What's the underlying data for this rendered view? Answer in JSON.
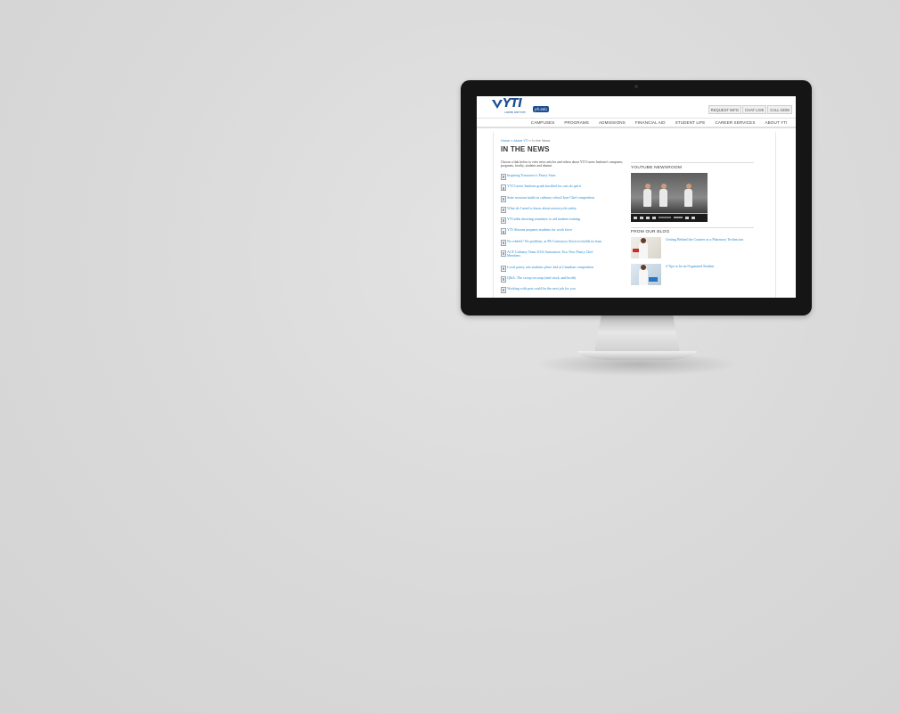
{
  "header": {
    "logo_text": "YTI",
    "logo_sub": "CAREER INSTITUTE",
    "logo_badge": "yti.edu",
    "top_buttons": [
      "REQUEST INFO",
      "CHAT LIVE",
      "CALL NOW"
    ]
  },
  "nav": [
    "CAMPUSES",
    "PROGRAMS",
    "ADMISSIONS",
    "FINANCIAL AID",
    "STUDENT LIFE",
    "CAREER SERVICES",
    "ABOUT YTI"
  ],
  "breadcrumb": {
    "home": "Home",
    "sep1": "»",
    "about": "About YTI",
    "sep2": "»",
    "current": "In the News"
  },
  "page_title": "IN THE NEWS",
  "intro": "Choose a link below to view news articles and videos about YTI Career Institute's campuses, programs, faculty, students and alumni.",
  "news": [
    {
      "title": "Inspiring Tomorrow's Pastry Stars"
    },
    {
      "title": "YTI Career Institute grads buckled for cats do spirit"
    },
    {
      "title": "State sessions battle in culinary school Iron Chef competition"
    },
    {
      "title": "What do I need to know about motorcycle safety"
    },
    {
      "title": "YTI adds shooting simulator to aid student training"
    },
    {
      "title": "YTI Altoona prepares students for work force"
    },
    {
      "title": "No wheels? No problem, as PA Contractor Services builds its base"
    },
    {
      "title": "ACF Culinary Team USA Announces Two New Pastry Chef",
      "title2": "Members"
    },
    {
      "title": "Local pastry arts students place 2nd at Canadian competition"
    },
    {
      "title": "Q&A: The scoop on soup (and stock, and broth)"
    },
    {
      "title": "Working with pets could be the next job for you"
    }
  ],
  "sidebar": {
    "youtube_heading": "YOUTUBE NEWSROOM",
    "blog_heading": "FROM OUR BLOG",
    "blog": [
      {
        "title": "Getting Behind the Counter as a Pharmacy Technician"
      },
      {
        "title": "4 Tips to be an Organized Student"
      }
    ]
  }
}
